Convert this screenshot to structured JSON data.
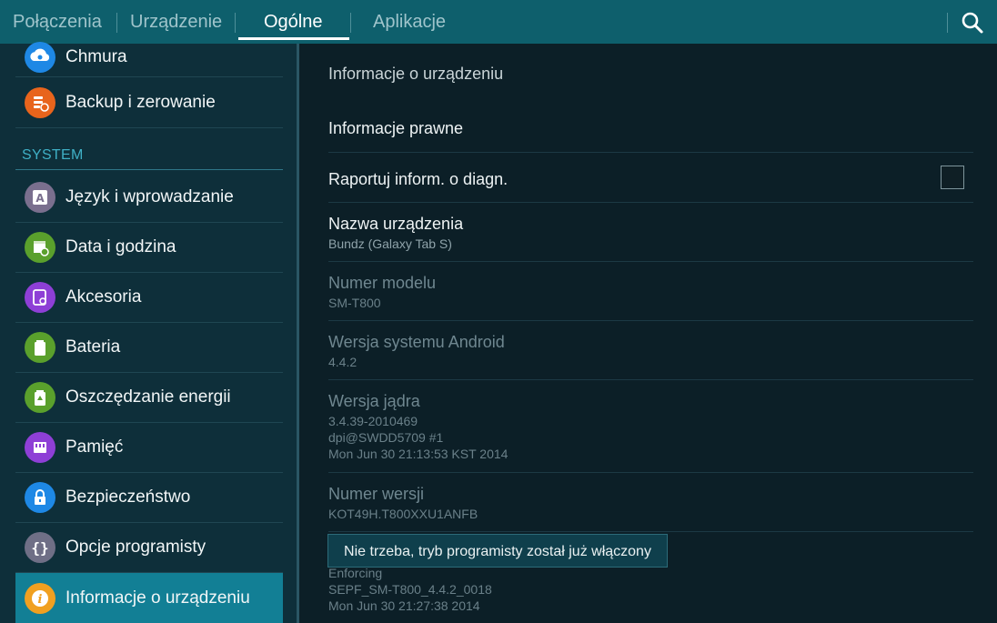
{
  "tabs": [
    {
      "label": "Połączenia"
    },
    {
      "label": "Urządzenie"
    },
    {
      "label": "Ogólne"
    },
    {
      "label": "Aplikacje"
    }
  ],
  "active_tab": "Ogólne",
  "search_icon": "search-icon",
  "sidebar": {
    "top_items": [
      {
        "label": "Chmura",
        "icon": "cloud-icon",
        "color": "#1e88e5"
      },
      {
        "label": "Backup i zerowanie",
        "icon": "backup-icon",
        "color": "#e8641c"
      }
    ],
    "section": "SYSTEM",
    "items": [
      {
        "label": "Język i wprowadzanie",
        "icon": "language-icon",
        "color": "#7a6f8e"
      },
      {
        "label": "Data i godzina",
        "icon": "calendar-icon",
        "color": "#5aa02c"
      },
      {
        "label": "Akcesoria",
        "icon": "accessory-icon",
        "color": "#8e3fd6"
      },
      {
        "label": "Bateria",
        "icon": "battery-icon",
        "color": "#5aa02c"
      },
      {
        "label": "Oszczędzanie energii",
        "icon": "power-saving-icon",
        "color": "#5aa02c"
      },
      {
        "label": "Pamięć",
        "icon": "storage-icon",
        "color": "#8e3fd6"
      },
      {
        "label": "Bezpieczeństwo",
        "icon": "lock-icon",
        "color": "#1e88e5"
      },
      {
        "label": "Opcje programisty",
        "icon": "developer-icon",
        "color": "#6f6f86"
      },
      {
        "label": "Informacje o urządzeniu",
        "icon": "info-icon",
        "color": "#f0a020"
      }
    ],
    "active_item": "Informacje o urządzeniu"
  },
  "main": {
    "header": "Informacje o urządzeniu",
    "legal": "Informacje prawne",
    "diag": {
      "title": "Raportuj inform. o diagn.",
      "checked": false
    },
    "device_name": {
      "title": "Nazwa urządzenia",
      "value": "Bundz (Galaxy Tab S)"
    },
    "model": {
      "title": "Numer modelu",
      "value": "SM-T800"
    },
    "android": {
      "title": "Wersja systemu Android",
      "value": "4.4.2"
    },
    "kernel": {
      "title": "Wersja jądra",
      "line1": "3.4.39-2010469",
      "line2": "dpi@SWDD5709 #1",
      "line3": "Mon Jun 30 21:13:53 KST 2014"
    },
    "build": {
      "title": "Numer wersji",
      "value": "KOT49H.T800XXU1ANFB"
    },
    "se": {
      "line1": "Enforcing",
      "line2": "SEPF_SM-T800_4.4.2_0018",
      "line3": "Mon Jun 30 21:27:38 2014"
    }
  },
  "toast": "Nie trzeba, tryb programisty został już włączony"
}
